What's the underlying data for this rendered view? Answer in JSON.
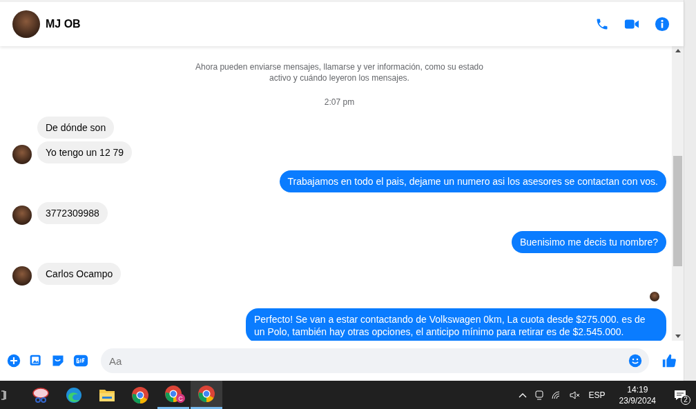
{
  "header": {
    "name": "MJ OB"
  },
  "messages": [
    {
      "kind": "system",
      "text": "Ahora pueden enviarse mensajes, llamarse y ver información, como su estado activo y cuándo leyeron los mensajes."
    },
    {
      "kind": "time",
      "text": "2:07 pm"
    },
    {
      "kind": "incoming",
      "text": "De dónde son",
      "avatar": false
    },
    {
      "kind": "incoming",
      "text": "Yo tengo un 12 79",
      "avatar": true
    },
    {
      "kind": "outgoing",
      "text": "Trabajamos en todo el pais, dejame un numero asi los asesores se contactan con vos."
    },
    {
      "kind": "incoming",
      "text": "3772309988",
      "avatar": true
    },
    {
      "kind": "outgoing",
      "text": "Buenisimo me decis tu nombre?"
    },
    {
      "kind": "incoming",
      "text": "Carlos Ocampo",
      "avatar": true
    },
    {
      "kind": "seen"
    },
    {
      "kind": "outgoing",
      "text": "Perfecto!  Se van a estar contactando de Volkswagen 0km, La cuota desde $275.000. es de un Polo, también hay otras opciones, el anticipo mínimo para retirar es de $2.545.000."
    }
  ],
  "composer": {
    "placeholder": "Aa"
  },
  "taskbar": {
    "apps": [
      {
        "kind": "snip",
        "running": false,
        "active": false
      },
      {
        "kind": "edge",
        "running": false,
        "active": false
      },
      {
        "kind": "folder",
        "running": false,
        "active": false
      },
      {
        "kind": "chrome",
        "running": false,
        "active": false
      },
      {
        "kind": "chrome",
        "badge": "C",
        "running": true,
        "active": false
      },
      {
        "kind": "chrome",
        "running": true,
        "active": true
      }
    ],
    "language": "ESP",
    "time": "14:19",
    "date": "23/9/2024",
    "notifications": "2"
  }
}
